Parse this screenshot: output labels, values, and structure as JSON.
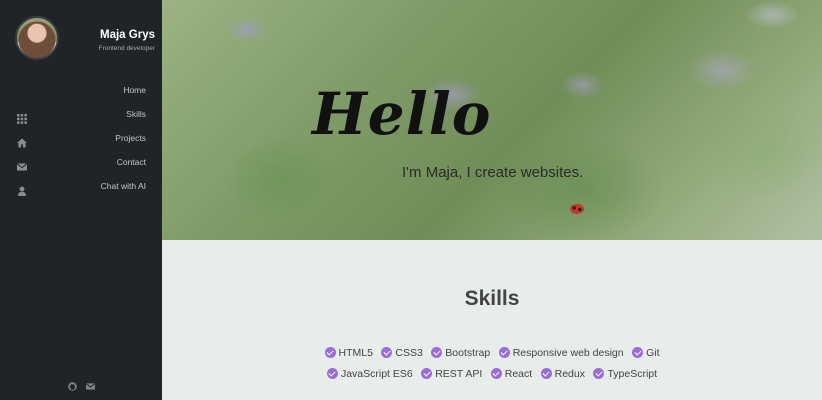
{
  "profile": {
    "name": "Maja Grys",
    "role": "Frontend developer"
  },
  "nav": {
    "items": [
      {
        "label": "Home",
        "icon": "none"
      },
      {
        "label": "Skills",
        "icon": "grid-icon"
      },
      {
        "label": "Projects",
        "icon": "home-icon"
      },
      {
        "label": "Contact",
        "icon": "envelope-icon"
      },
      {
        "label": "Chat with AI",
        "icon": "user-icon"
      }
    ]
  },
  "footer": {
    "icons": [
      "github-icon",
      "envelope-icon"
    ]
  },
  "hero": {
    "title": "Hello",
    "subtitle": "I'm Maja, I create websites."
  },
  "skills": {
    "title": "Skills",
    "row1": [
      "HTML5",
      "CSS3",
      "Bootstrap",
      "Responsive web design",
      "Git"
    ],
    "row2": [
      "JavaScript ES6",
      "REST API",
      "React",
      "Redux",
      "TypeScript"
    ]
  },
  "colors": {
    "sidebar_bg": "#212427",
    "accent_check": "#9a6dd6",
    "page_bg": "#e8eceb"
  }
}
